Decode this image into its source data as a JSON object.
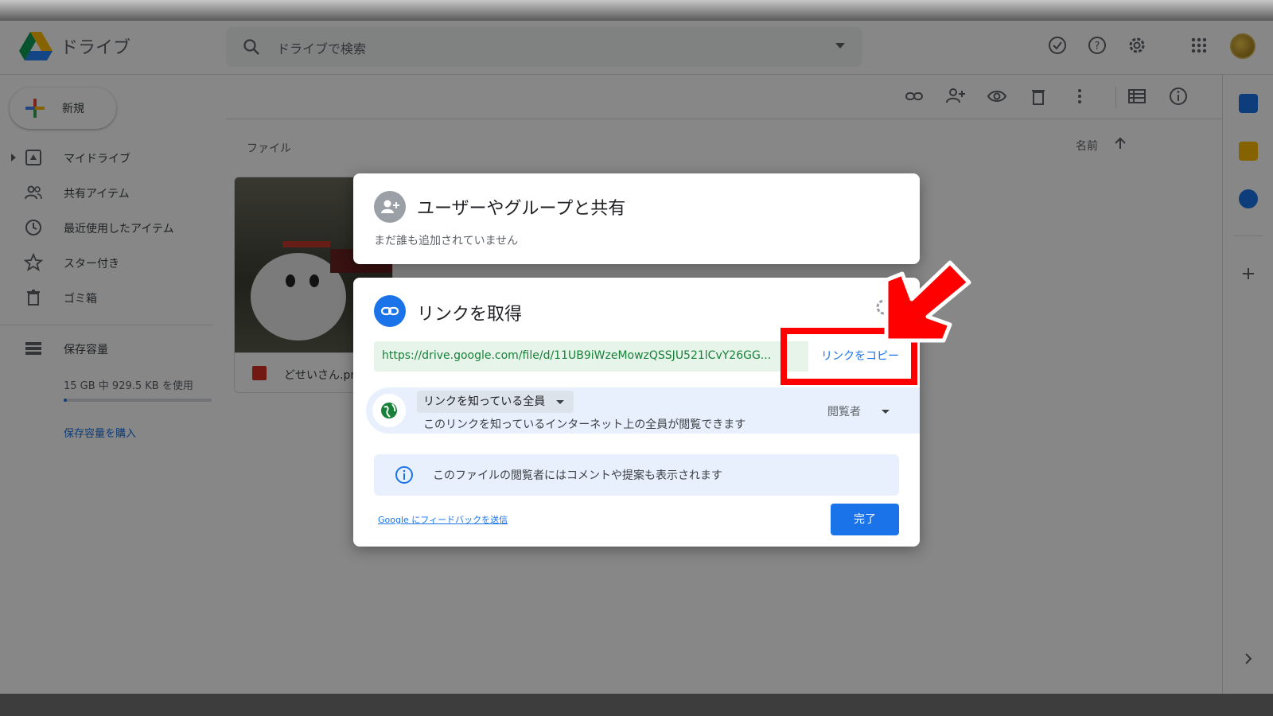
{
  "app": {
    "brand": "ドライブ",
    "search_placeholder": "ドライブで検索"
  },
  "sidebar": {
    "new_label": "新規",
    "items": [
      {
        "label": "マイドライブ"
      },
      {
        "label": "共有アイテム"
      },
      {
        "label": "最近使用したアイテム"
      },
      {
        "label": "スター付き"
      },
      {
        "label": "ゴミ箱"
      }
    ],
    "storage": {
      "label": "保存容量",
      "usage_text": "15 GB 中 929.5 KB を使用",
      "used_fraction": 0.01,
      "buy_label": "保存容量を購入"
    }
  },
  "content": {
    "section_label": "ファイル",
    "sort_label": "名前",
    "file_name": "どせいさん.pr"
  },
  "share_dialog": {
    "title": "ユーザーやグループと共有",
    "subtitle": "まだ誰も追加されていません"
  },
  "link_dialog": {
    "title": "リンクを取得",
    "url": "https://drive.google.com/file/d/11UB9iWzeMowzQSSJU521lCvY26GG...",
    "copy_label": "リンクをコピー",
    "access_scope": "リンクを知っている全員",
    "access_description": "このリンクを知っているインターネット上の全員が閲覧できます",
    "role": "閲覧者",
    "info_text": "このファイルの閲覧者にはコメントや提案も表示されます",
    "feedback_link": "Google にフィードバックを送信",
    "done_label": "完了"
  },
  "colors": {
    "accent": "#1a73e8",
    "callout": "#ff0000",
    "url_text": "#188038"
  },
  "icons": {
    "header": [
      "check-circle-icon",
      "help-icon",
      "settings-icon",
      "apps-grid-icon"
    ],
    "toolbar": [
      "link-icon",
      "add-person-icon",
      "preview-eye-icon",
      "trash-icon",
      "more-vert-icon",
      "list-view-icon",
      "info-icon"
    ]
  }
}
